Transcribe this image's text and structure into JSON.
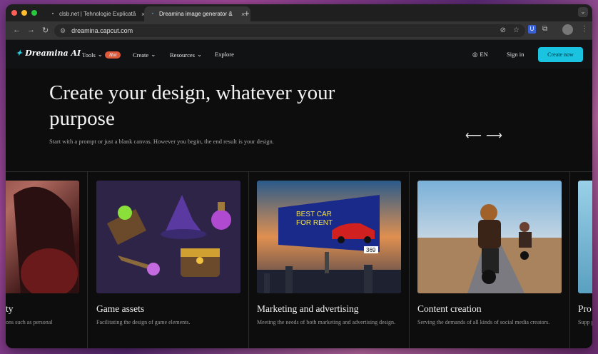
{
  "browser": {
    "tabs": [
      {
        "title": "clsb.net | Tehnologie Explicată",
        "favicon": "clsb-favicon",
        "active": false
      },
      {
        "title": "Dreamina image generator & ",
        "favicon": "dreamina-favicon",
        "active": true
      }
    ],
    "url": "dreamina.capcut.com"
  },
  "site": {
    "logo": "Dreamina AI",
    "nav": {
      "tools": "Tools",
      "hot_badge": "Hot",
      "create": "Create",
      "resources": "Resources",
      "explore": "Explore"
    },
    "lang": "EN",
    "sign_in": "Sign in",
    "create_now": "Create now",
    "accent_color": "#1ac4e0"
  },
  "hero": {
    "title": "Create your design, whatever your purpose",
    "subtitle": "Start with a prompt or just a blank canvas. However you begin, the end result is your design."
  },
  "cards": [
    {
      "title": "ty",
      "desc": "ons such as personal"
    },
    {
      "title": "Game assets",
      "desc": "Facilitating the design of game elements."
    },
    {
      "title": "Marketing and advertising",
      "desc": "Meeting the needs of both marketing and advertising design."
    },
    {
      "title": "Content creation",
      "desc": "Serving the demands of all kinds of social media creators."
    },
    {
      "title": "Pro",
      "desc": "Supp produ"
    }
  ],
  "billboard": {
    "line1": "BEST CAR",
    "line2": "FOR RENT",
    "price": "369"
  }
}
